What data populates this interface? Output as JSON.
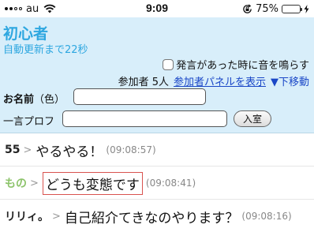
{
  "status_bar": {
    "carrier": "au",
    "time": "9:09",
    "battery_percent": "75%",
    "battery_level": 0.75
  },
  "room": {
    "title": "初心者",
    "auto_update": "自動更新まで22秒"
  },
  "controls": {
    "sound_checkbox_label": "発言があった時に音を鳴らす",
    "participants": "参加者 5人",
    "panel_link": "参加者パネルを表示",
    "move_down_link": "▼下移動",
    "name_label": "お名前",
    "color_label": "（色）",
    "name_value": "",
    "profile_label": "一言プロフ",
    "profile_value": "",
    "enter_button": "入室"
  },
  "colors": {
    "accent": "#2ea7e0",
    "header_bg": "#d8eefa",
    "link": "#1a47c7",
    "highlight_border": "#d9534f"
  },
  "messages": [
    {
      "speaker": "55",
      "separator": ">",
      "text": "やるやる！",
      "time": "(09:08:57)",
      "speaker_color": "#222222",
      "boxed": false
    },
    {
      "speaker": "もの",
      "separator": ">",
      "text": "どうも変態です",
      "time": "(09:08:41)",
      "speaker_color": "#8cc36a",
      "boxed": true
    },
    {
      "speaker": "リリィ。",
      "separator": ">",
      "text": "自己紹介てきなのやります？",
      "time": "(09:08:16)",
      "speaker_color": "#222222",
      "boxed": false
    }
  ]
}
